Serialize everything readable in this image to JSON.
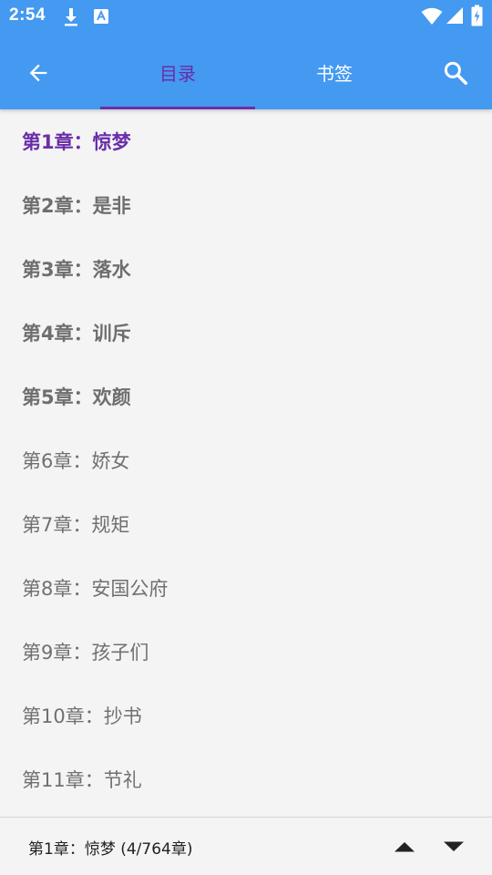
{
  "status_bar": {
    "time": "2:54",
    "icons": [
      "download-icon",
      "font-app-icon",
      "wifi-icon",
      "signal-icon",
      "battery-icon"
    ]
  },
  "app_bar": {
    "back_icon": "arrow-left-icon",
    "search_icon": "search-icon",
    "tabs": [
      {
        "label": "目录",
        "selected": true
      },
      {
        "label": "书签",
        "selected": false
      }
    ]
  },
  "chapters": [
    {
      "label": "第1章：惊梦",
      "state": "current"
    },
    {
      "label": "第2章：是非",
      "state": "read"
    },
    {
      "label": "第3章：落水",
      "state": "read"
    },
    {
      "label": "第4章：训斥",
      "state": "read"
    },
    {
      "label": "第5章：欢颜",
      "state": "read"
    },
    {
      "label": "第6章：娇女",
      "state": "unread"
    },
    {
      "label": "第7章：规矩",
      "state": "unread"
    },
    {
      "label": "第8章：安国公府",
      "state": "unread"
    },
    {
      "label": "第9章：孩子们",
      "state": "unread"
    },
    {
      "label": "第10章：抄书",
      "state": "unread"
    },
    {
      "label": "第11章：节礼",
      "state": "unread"
    }
  ],
  "bottom_bar": {
    "position_text": "第1章：惊梦 (4/764章)",
    "up_icon": "triangle-up-icon",
    "down_icon": "triangle-down-icon"
  },
  "colors": {
    "app_bar": "#4499f1",
    "accent": "#6a2ea8",
    "background": "#f4f4f4",
    "text_muted": "#707070"
  }
}
